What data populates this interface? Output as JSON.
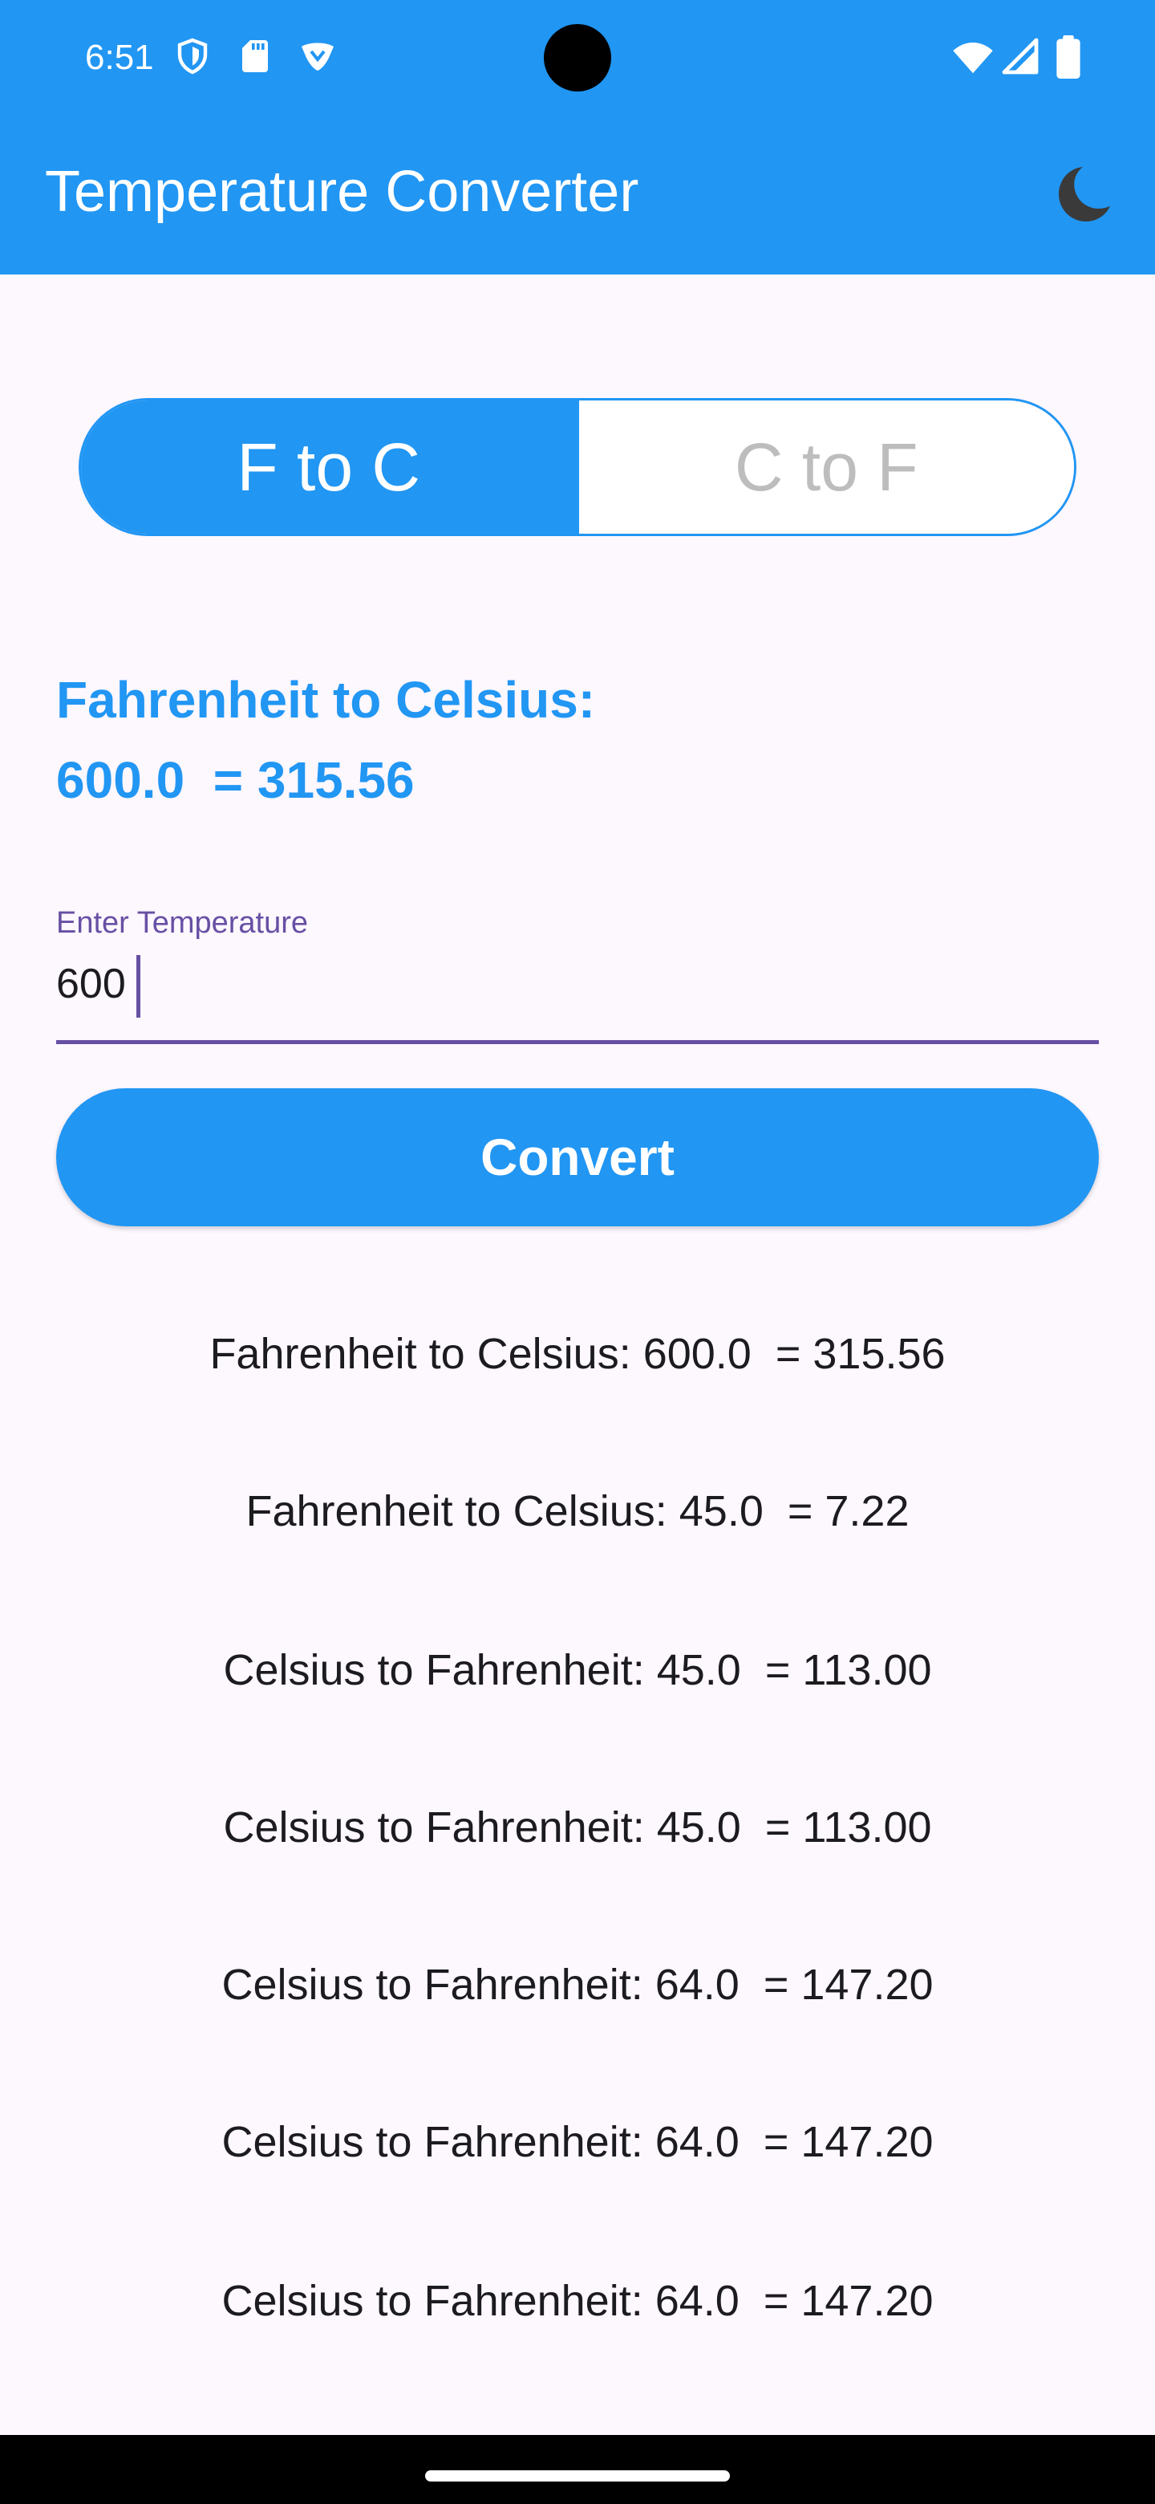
{
  "status_bar": {
    "time": "6:51",
    "icons_left": [
      "shield-icon",
      "sd-card-icon",
      "vpn-icon"
    ],
    "icons_right": [
      "wifi-icon",
      "cellular-signal-icon",
      "battery-icon"
    ]
  },
  "app_bar": {
    "title": "Temperature Converter",
    "theme_icon": "moon-icon",
    "color": "#2196F3"
  },
  "mode_toggle": {
    "options": [
      {
        "label": "F to C",
        "selected": true
      },
      {
        "label": "C to F",
        "selected": false
      }
    ]
  },
  "result": {
    "title": "Fahrenheit to Celsius:",
    "value": "600.0  = 315.56"
  },
  "input": {
    "label": "Enter Temperature",
    "value": "600"
  },
  "convert_button": {
    "label": "Convert"
  },
  "history": [
    "Fahrenheit to Celsius: 600.0  = 315.56",
    "Fahrenheit to Celsius: 45.0  = 7.22",
    "Celsius to Fahrenheit: 45.0  = 113.00",
    "Celsius to Fahrenheit: 45.0  = 113.00",
    "Celsius to Fahrenheit: 64.0  = 147.20",
    "Celsius to Fahrenheit: 64.0  = 147.20",
    "Celsius to Fahrenheit: 64.0  = 147.20"
  ]
}
